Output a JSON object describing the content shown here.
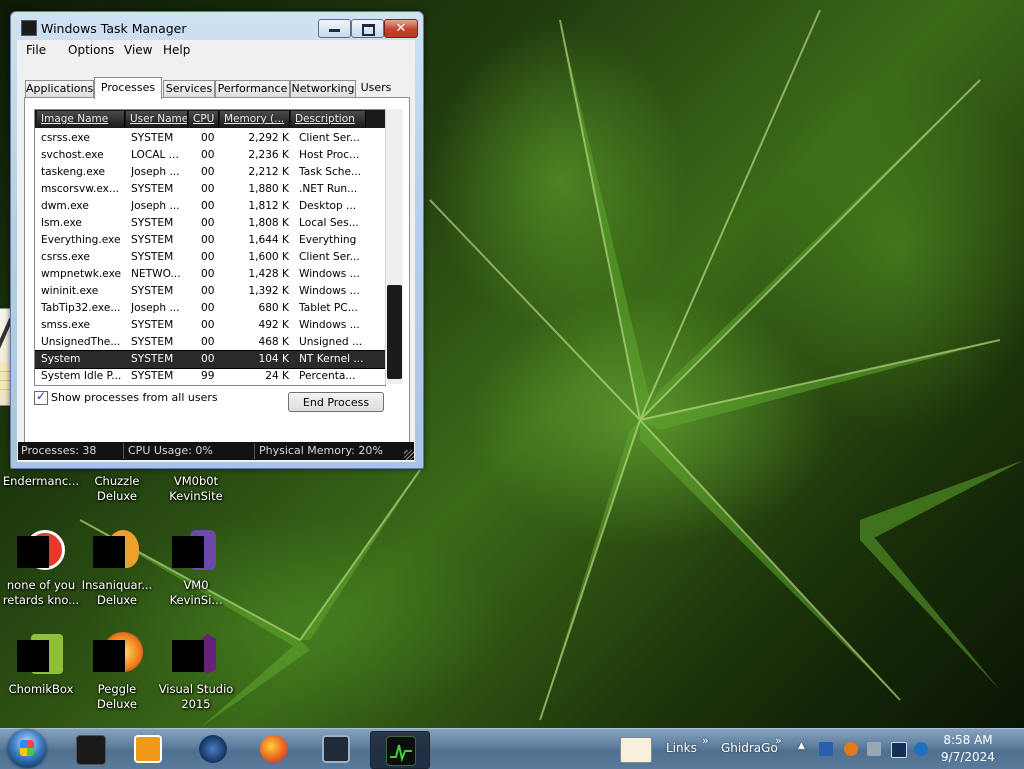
{
  "window": {
    "title": "Windows Task Manager",
    "menu": [
      "File",
      "Options",
      "View",
      "Help"
    ],
    "tabs": [
      "Applications",
      "Processes",
      "Services",
      "Performance",
      "Networking",
      "Users"
    ],
    "active_tab": "Processes",
    "columns": [
      "Image Name",
      "User Name",
      "CPU",
      "Memory (...",
      "Description"
    ],
    "rows": [
      {
        "name": "csrss.exe",
        "user": "SYSTEM",
        "cpu": "00",
        "mem": "2,292 K",
        "desc": "Client Ser..."
      },
      {
        "name": "svchost.exe",
        "user": "LOCAL ...",
        "cpu": "00",
        "mem": "2,236 K",
        "desc": "Host Proc..."
      },
      {
        "name": "taskeng.exe",
        "user": "Joseph ...",
        "cpu": "00",
        "mem": "2,212 K",
        "desc": "Task Sche..."
      },
      {
        "name": "mscorsvw.ex...",
        "user": "SYSTEM",
        "cpu": "00",
        "mem": "1,880 K",
        "desc": ".NET Run..."
      },
      {
        "name": "dwm.exe",
        "user": "Joseph ...",
        "cpu": "00",
        "mem": "1,812 K",
        "desc": "Desktop ..."
      },
      {
        "name": "lsm.exe",
        "user": "SYSTEM",
        "cpu": "00",
        "mem": "1,808 K",
        "desc": "Local Ses..."
      },
      {
        "name": "Everything.exe",
        "user": "SYSTEM",
        "cpu": "00",
        "mem": "1,644 K",
        "desc": "Everything"
      },
      {
        "name": "csrss.exe",
        "user": "SYSTEM",
        "cpu": "00",
        "mem": "1,600 K",
        "desc": "Client Ser..."
      },
      {
        "name": "wmpnetwk.exe",
        "user": "NETWO...",
        "cpu": "00",
        "mem": "1,428 K",
        "desc": "Windows ..."
      },
      {
        "name": "wininit.exe",
        "user": "SYSTEM",
        "cpu": "00",
        "mem": "1,392 K",
        "desc": "Windows ..."
      },
      {
        "name": "TabTip32.exe...",
        "user": "Joseph ...",
        "cpu": "00",
        "mem": "680 K",
        "desc": "Tablet PC..."
      },
      {
        "name": "smss.exe",
        "user": "SYSTEM",
        "cpu": "00",
        "mem": "492 K",
        "desc": "Windows ..."
      },
      {
        "name": "UnsignedThe...",
        "user": "SYSTEM",
        "cpu": "00",
        "mem": "468 K",
        "desc": "Unsigned ..."
      },
      {
        "name": "System",
        "user": "SYSTEM",
        "cpu": "00",
        "mem": "104 K",
        "desc": "NT Kernel ..."
      },
      {
        "name": "System Idle P...",
        "user": "SYSTEM",
        "cpu": "99",
        "mem": "24 K",
        "desc": "Percenta..."
      }
    ],
    "selected_row": 13,
    "show_all_label": "Show processes from all users",
    "show_all_checked": true,
    "end_process_label": "End Process",
    "status": {
      "processes": "Processes: 38",
      "cpu": "CPU Usage: 0%",
      "memory": "Physical Memory: 20%"
    }
  },
  "desktop_icons": [
    {
      "label": "Endermanc...",
      "icon": "app-icon"
    },
    {
      "label": "Chuzzle\nDeluxe",
      "icon": "game-icon"
    },
    {
      "label": "VM0b0t\nKevinSite",
      "icon": "app-icon"
    },
    {
      "label": "none of you\nretards kno...",
      "icon": "app-icon",
      "color": "#e23b2a"
    },
    {
      "label": "Insaniquar...\nDeluxe",
      "icon": "fish-game-icon",
      "color": "#f0a02a"
    },
    {
      "label": "VM0\nKevinSi...",
      "icon": "app-icon",
      "color": "#6b4aa8"
    },
    {
      "label": "ChomikBox",
      "icon": "hamster-icon",
      "color": "#8fc03a"
    },
    {
      "label": "Peggle Deluxe",
      "icon": "peggle-icon",
      "color": "#f07a1a"
    },
    {
      "label": "Visual Studio\n2015",
      "icon": "visual-studio-icon",
      "color": "#68217a"
    }
  ],
  "taskbar": {
    "pinned": [
      {
        "name": "start-button",
        "icon": "windows-orb-icon"
      },
      {
        "name": "taskbar-app-1",
        "icon": "black-box-icon",
        "color": "#1a1a1a"
      },
      {
        "name": "taskbar-app-2",
        "icon": "media-player-icon",
        "color": "#f09a1a"
      },
      {
        "name": "taskbar-app-3",
        "icon": "globe-icon",
        "color": "#1c3d6b"
      },
      {
        "name": "taskbar-app-4",
        "icon": "firefox-icon",
        "color": "#e8621c"
      },
      {
        "name": "taskbar-app-5",
        "icon": "monitor-icon",
        "color": "#1f2a36"
      },
      {
        "name": "taskbar-app-6",
        "icon": "task-manager-icon",
        "color": "#0d0d0d"
      }
    ],
    "toolbar_links": "Links",
    "toolbar_ghidra": "GhidraGo",
    "chevron": "»",
    "clock_time": "8:58 AM",
    "clock_date": "9/7/2024"
  }
}
